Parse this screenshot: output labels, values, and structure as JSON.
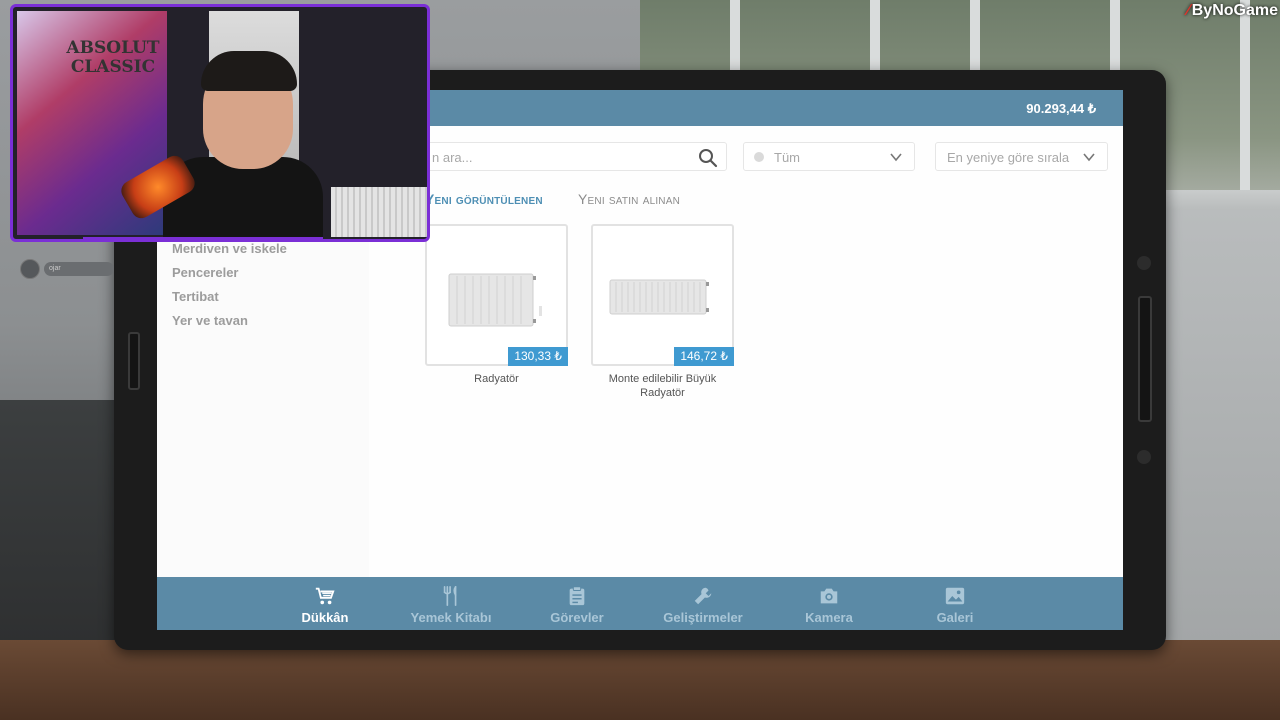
{
  "overlay": {
    "channel_name": "ByNoGame",
    "poster_text": "ABSOLUT\nCLASSIC",
    "avatar_label": "ojar"
  },
  "header": {
    "balance": "90.293,44 ₺"
  },
  "search": {
    "placeholder": "n ara..."
  },
  "filter": {
    "selected": "Tüm"
  },
  "sort": {
    "selected": "En yeniye göre sırala"
  },
  "tabs": [
    {
      "label": "Yeni görüntülenen",
      "active": true
    },
    {
      "label": "Yeni satın alınan",
      "active": false
    }
  ],
  "sidebar": {
    "items": [
      {
        "label": "Merdiven ve iskele"
      },
      {
        "label": "Pencereler"
      },
      {
        "label": "Tertibat"
      },
      {
        "label": "Yer ve tavan"
      }
    ]
  },
  "products": [
    {
      "name": "Radyatör",
      "price": "130,33 ₺"
    },
    {
      "name": "Monte edilebilir Büyük Radyatör",
      "price": "146,72 ₺"
    }
  ],
  "bottom_nav": [
    {
      "label": "Dükkân",
      "icon": "cart-icon",
      "active": true
    },
    {
      "label": "Yemek Kitabı",
      "icon": "fork-knife-icon",
      "active": false
    },
    {
      "label": "Görevler",
      "icon": "clipboard-icon",
      "active": false
    },
    {
      "label": "Geliştirmeler",
      "icon": "wrench-icon",
      "active": false
    },
    {
      "label": "Kamera",
      "icon": "camera-icon",
      "active": false
    },
    {
      "label": "Galeri",
      "icon": "image-icon",
      "active": false
    }
  ],
  "colors": {
    "accent": "#5b8aa6",
    "price_badge": "#3f9ad1",
    "active_tab": "#4e8fb4",
    "webcam_border": "#7b2fd6"
  }
}
